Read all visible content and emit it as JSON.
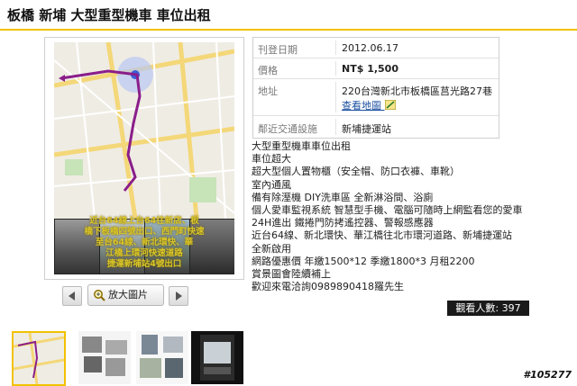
{
  "page": {
    "title": "板橋 新埔 大型重型機車 車位出租"
  },
  "info": [
    {
      "key": "刊登日期",
      "value": "2012.06.17"
    },
    {
      "key": "價格",
      "value": "NT$ 1,500"
    },
    {
      "key": "地址",
      "value": "220台灣新北市板橋區莒光路27巷",
      "link": "查看地圖"
    },
    {
      "key": "鄰近交通設施",
      "value": "新埔捷運站"
    }
  ],
  "description": [
    "大型重型機車車位出租",
    " 車位超大",
    " 超大型個人置物櫃（安全帽、防口衣褲、車靴）",
    " 室內通風",
    "備有除溼機 DIY洗車區 全新淋浴間、浴廁",
    "個人愛車監視系統 智慧型手機、電腦可隨時上網監看您的愛車",
    "24H進出 鐵捲門防拷遙控器、警報感應器",
    "近台64線、新北環快、華江橋往北市環河道路、新埔捷運站",
    "全新啟用",
    "網路優惠價 年繳1500*12 季繳1800*3 月租2200",
    "賞景圖會陸續補上",
    "歡迎來電洽詢0989890418羅先生"
  ],
  "gallery": {
    "caption": [
      "近台64線上台64往新店、板",
      "橋下板橋四號出口、西門町快速",
      "至台64線、新北環快、華",
      "江橋上環河快速道路",
      "捷運新埔站4號出口"
    ],
    "zoom_label": "放大圖片",
    "thumb_count": 4
  },
  "views": {
    "label": "觀看人數: 397"
  },
  "watermark": "#105277",
  "colors": {
    "accent": "#f2c200",
    "link": "#1a4fa0",
    "price": "#111111"
  }
}
